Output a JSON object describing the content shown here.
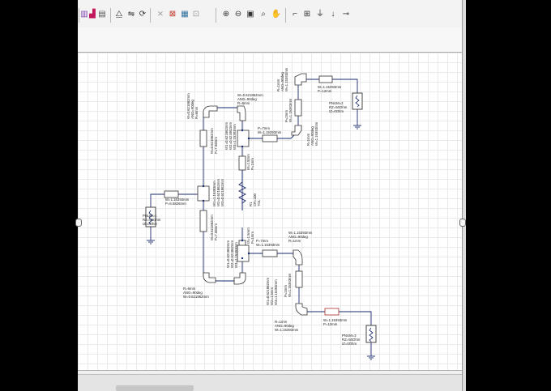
{
  "toolbar": {
    "icons": [
      "tool-icon-1",
      "chart-icon",
      "tool-icon-3",
      "tune-icon",
      "flip-icon",
      "rotate-icon",
      "disable-icon",
      "deactivate-icon",
      "equation-icon",
      "grid-snap-icon",
      "zoom-in-icon",
      "zoom-out-icon",
      "zoom-fit-icon",
      "zoom-area-icon",
      "pan-hand-icon",
      "wire-icon",
      "port-icon",
      "ground-icon",
      "marker-icon",
      "probe-icon"
    ]
  },
  "schematic": {
    "tl_left_corner": [
      "W=0.621862mm",
      "ANG=90deg",
      "R=6mm"
    ],
    "tl_top_corner": [
      "W=0.621862mm",
      "ANG=90deg",
      "R=6mm"
    ],
    "left_upper_line": [
      "W=0.621862mm",
      "P=7.68mm"
    ],
    "junction_upper": [
      "W1=1.15393mm",
      "W2=0.621862mm",
      "W3=0.621862mm"
    ],
    "upper_tee": [
      "W1=0.621862mm",
      "W2=0.621862mm",
      "W3=1.15393mm"
    ],
    "tline_upper_right": [
      "P=7mm",
      "W=1.15393mm"
    ],
    "top_corner": [
      "R=1mm",
      "ANG=90deg",
      "W=1.15393mm"
    ],
    "top_vertical_line": [
      "P=2mm",
      "W=1.15393mm"
    ],
    "upper_corner_right": [
      "R=1mm",
      "ANG=90deg",
      "W=1.15393mm"
    ],
    "tline_top_right": [
      "W=1.15393mm",
      "P=12mm"
    ],
    "port2": [
      "PNUM=2",
      "RZ=50Ohm",
      "IZ=0Ohm"
    ],
    "mid_vertical_upper": [
      "W=1.5mm",
      "P=1mm"
    ],
    "resistor": [
      "R1",
      "CR=100",
      "TOL"
    ],
    "tline_left_port": [
      "W=1.15393mm",
      "P=6.5826mm"
    ],
    "port1": [
      "PNUM=1",
      "RZ=50Ohm",
      "IZ=0Ohm"
    ],
    "left_lower_line": [
      "W=0.621862mm",
      "P=7.68mm"
    ],
    "junction_lower": [
      "W1=0.621862mm",
      "W2=0.621862mm",
      "W3=1.15393mm"
    ],
    "mid_vertical_lower": [
      "W=1.5mm",
      "P=1mm"
    ],
    "lower_tee": [
      "W1=0.621862mm",
      "W2=1.5mm",
      "W3=1.15393mm"
    ],
    "tline_lower_mid": [
      "P=7mm",
      "W=1.15393mm"
    ],
    "lower_corner_right": [
      "W=1.15393mm",
      "ANG=90deg",
      "R=1mm"
    ],
    "bottom_left_corner": [
      "R=6mm",
      "ANG=90deg",
      "W=0.621862mm"
    ],
    "bottom_mid_corner": [
      "R=6mm",
      "ANG=90deg",
      "W=0.621862mm"
    ],
    "lower_vertical_line": [
      "P=2mm",
      "W=1.15393mm"
    ],
    "bottom_corner": [
      "R=1mm",
      "ANG=90deg",
      "W=1.15393mm"
    ],
    "tline_bottom_right": [
      "W=1.15393mm",
      "P=12mm"
    ],
    "port3": [
      "PNUM=3",
      "RZ=50Ohm",
      "IZ=0Ohm"
    ]
  }
}
